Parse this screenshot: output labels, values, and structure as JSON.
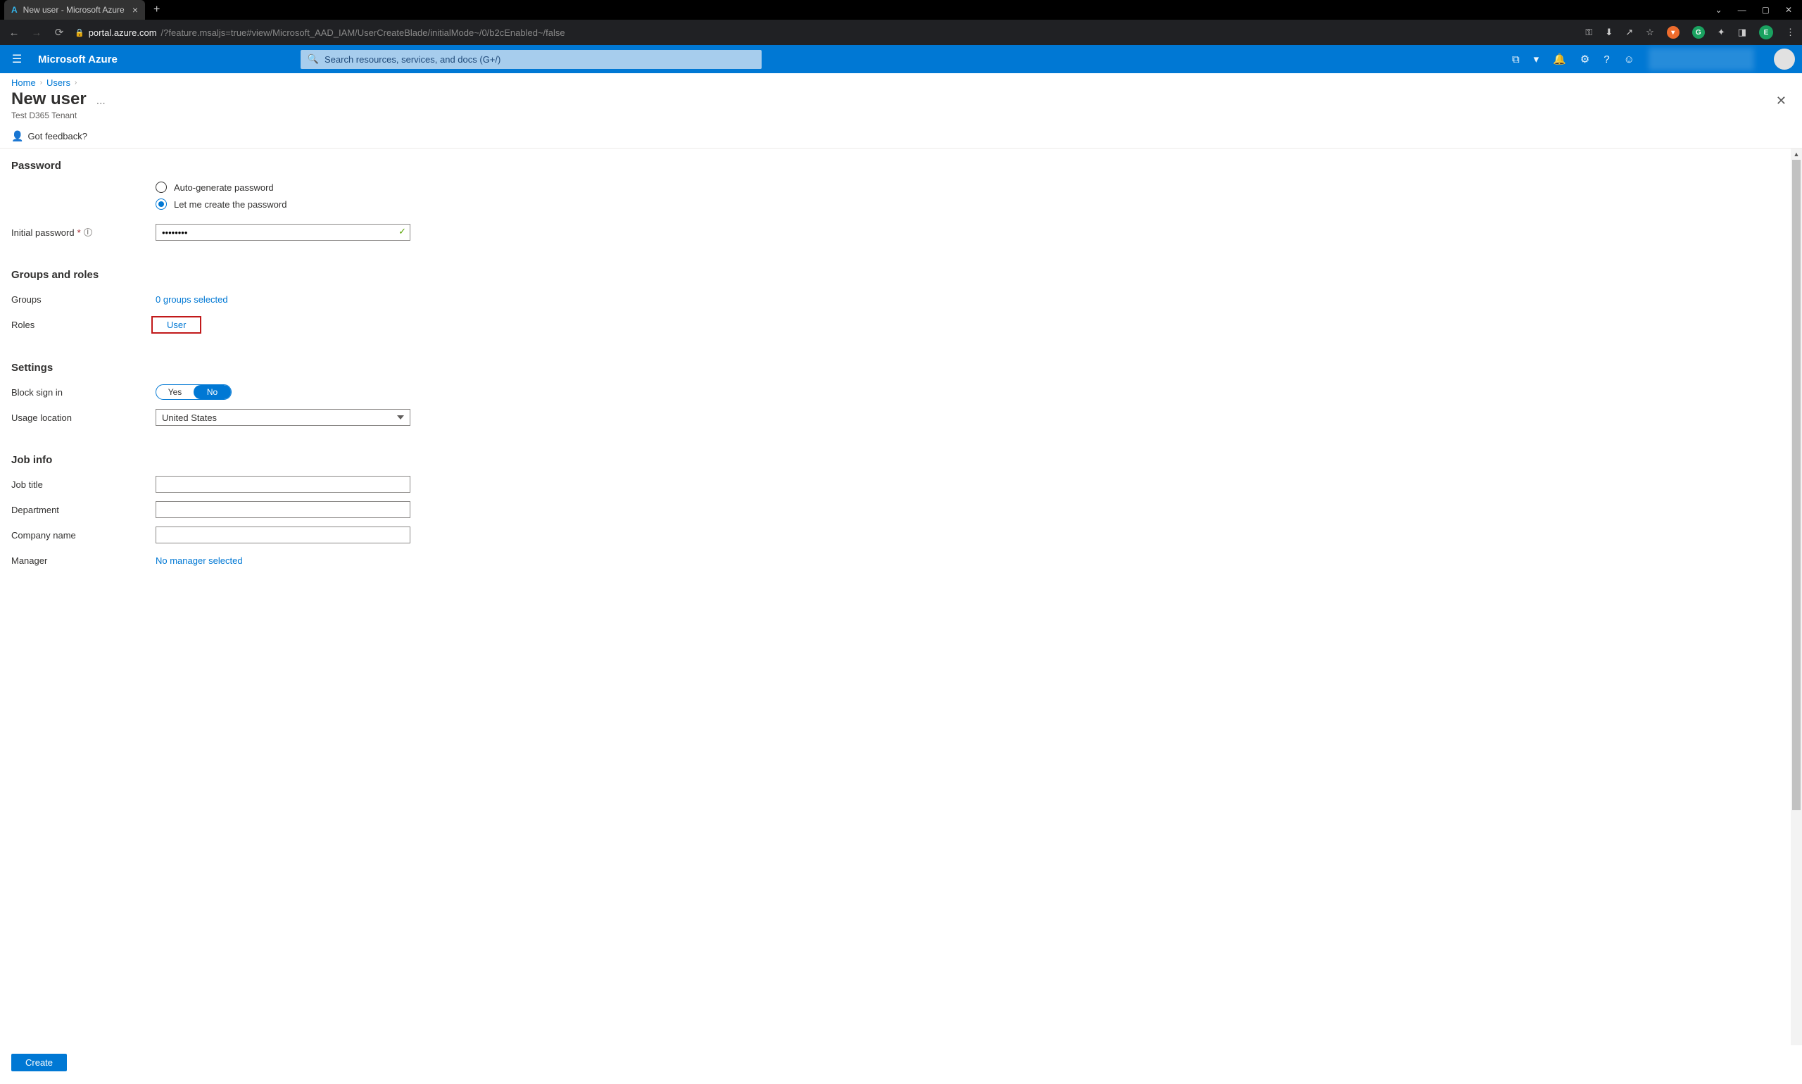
{
  "browser": {
    "tab_title": "New user - Microsoft Azure",
    "url_host": "portal.azure.com",
    "url_path": "/?feature.msaljs=true#view/Microsoft_AAD_IAM/UserCreateBlade/initialMode~/0/b2cEnabled~/false",
    "avatar_initial": "E"
  },
  "header": {
    "brand": "Microsoft Azure",
    "search_placeholder": "Search resources, services, and docs (G+/)"
  },
  "breadcrumb": {
    "items": [
      "Home",
      "Users"
    ]
  },
  "blade": {
    "title": "New user",
    "subtitle": "Test D365 Tenant",
    "feedback_label": "Got feedback?"
  },
  "sections": {
    "password": {
      "title": "Password",
      "auto_label": "Auto-generate password",
      "manual_label": "Let me create the password",
      "selected": "manual",
      "initial_password_label": "Initial password",
      "initial_password_value": "••••••••"
    },
    "groups_roles": {
      "title": "Groups and roles",
      "groups_label": "Groups",
      "groups_value": "0 groups selected",
      "roles_label": "Roles",
      "roles_value": "User"
    },
    "settings": {
      "title": "Settings",
      "block_signin_label": "Block sign in",
      "toggle_yes": "Yes",
      "toggle_no": "No",
      "toggle_value": "No",
      "usage_location_label": "Usage location",
      "usage_location_value": "United States"
    },
    "job_info": {
      "title": "Job info",
      "job_title_label": "Job title",
      "job_title_value": "",
      "department_label": "Department",
      "department_value": "",
      "company_label": "Company name",
      "company_value": "",
      "manager_label": "Manager",
      "manager_value": "No manager selected"
    }
  },
  "footer": {
    "create_label": "Create"
  }
}
